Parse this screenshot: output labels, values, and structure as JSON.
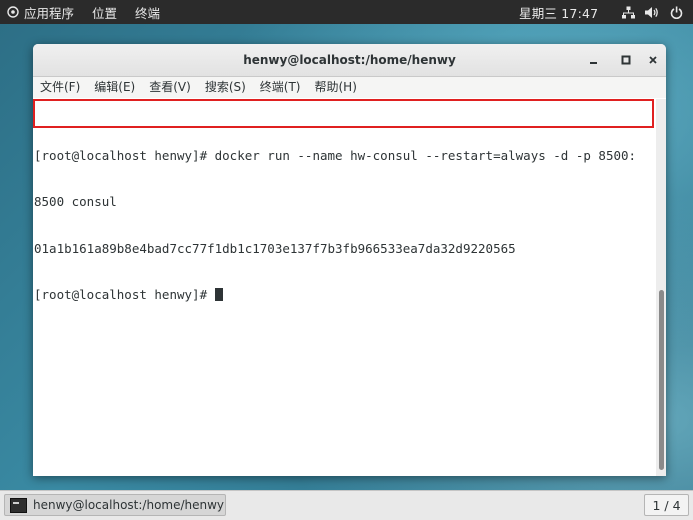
{
  "topbar": {
    "applications": "应用程序",
    "places": "位置",
    "terminal": "终端",
    "clock": "星期三 17:47",
    "icons": [
      "network-icon",
      "volume-icon",
      "power-icon"
    ]
  },
  "window": {
    "title": "henwy@localhost:/home/henwy",
    "controls": {
      "minimize": "‒",
      "maximize": "□",
      "close": "×"
    },
    "menu": [
      "文件(F)",
      "编辑(E)",
      "查看(V)",
      "搜索(S)",
      "终端(T)",
      "帮助(H)"
    ]
  },
  "terminal": {
    "lines": [
      "[root@localhost henwy]# docker run --name hw-consul --restart=always -d -p 8500:",
      "8500 consul",
      "01a1b161a89b8e4bad7cc77f1db1c1703e137f7b3fb966533ea7da32d9220565",
      "[root@localhost henwy]# "
    ],
    "highlight_color": "#e02020"
  },
  "taskbar": {
    "task_label": "henwy@localhost:/home/henwy",
    "workspace": "1 / 4"
  }
}
